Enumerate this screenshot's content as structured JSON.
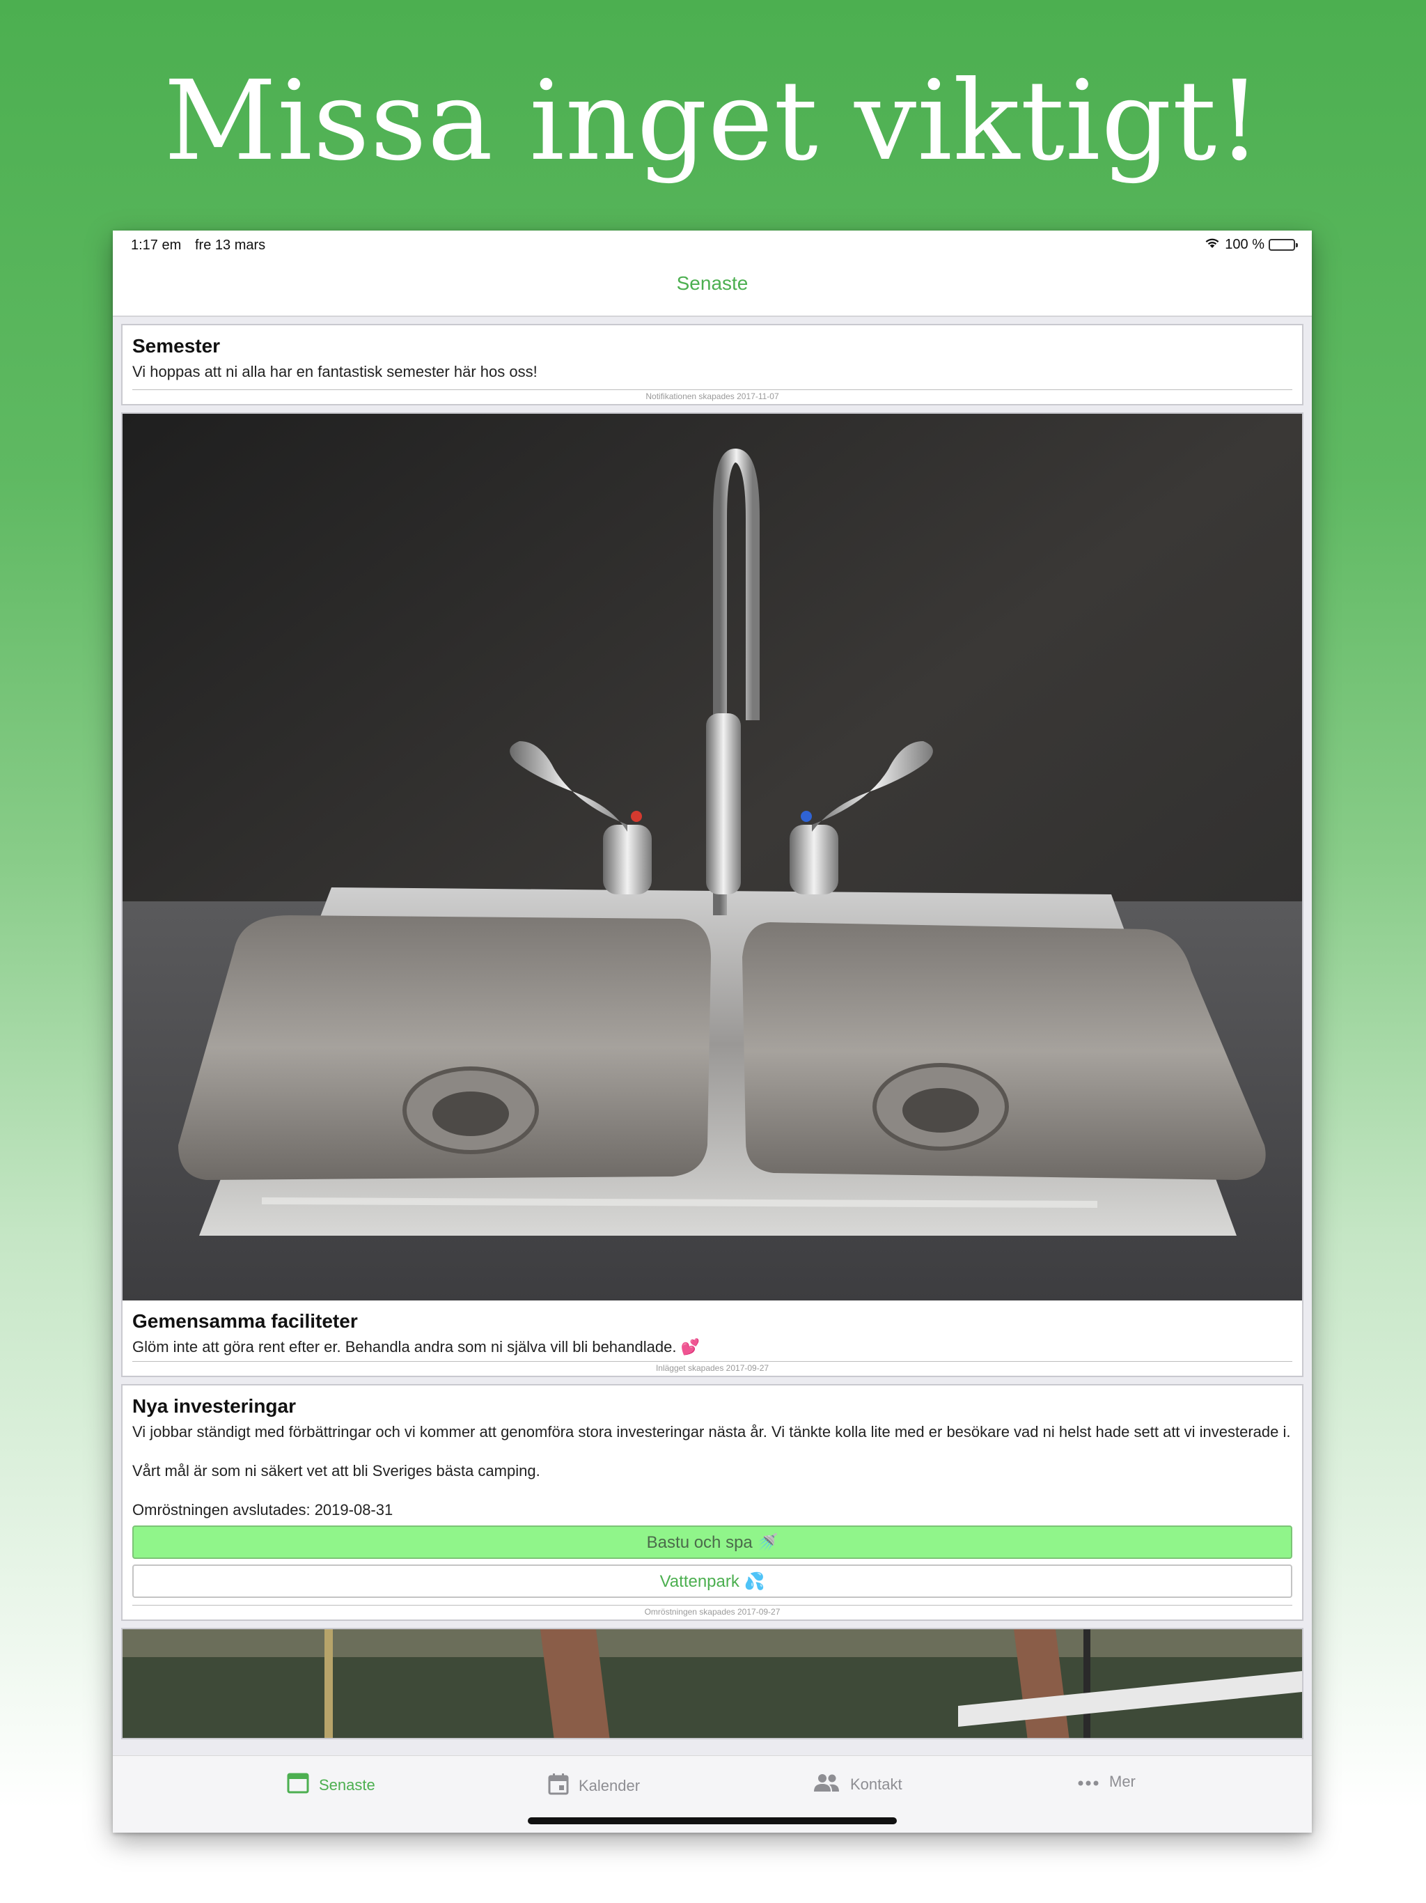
{
  "headline": "Missa inget viktigt!",
  "status_bar": {
    "time": "1:17 em",
    "date": "fre 13 mars",
    "battery": "100 %"
  },
  "nav": {
    "title": "Senaste"
  },
  "cards": {
    "semester": {
      "title": "Semester",
      "text": "Vi hoppas att ni alla har en fantastisk semester här hos oss!",
      "footer": "Notifikationen skapades 2017-11-07"
    },
    "faciliteter": {
      "title": "Gemensamma faciliteter",
      "text": "Glöm inte att göra rent efter er. Behandla andra som ni själva vill bli behandlade. 💕",
      "footer": "Inlägget skapades 2017-09-27"
    },
    "investeringar": {
      "title": "Nya investeringar",
      "paragraph1": "Vi jobbar ständigt med förbättringar och vi kommer att genomföra stora investeringar nästa år. Vi tänkte kolla lite med er besökare vad ni helst hade sett att vi investerade i.",
      "paragraph2": "Vårt mål är som ni säkert vet att bli Sveriges bästa camping.",
      "deadline": "Omröstningen avslutades: 2019-08-31",
      "options": [
        "Bastu och spa 🚿",
        "Vattenpark 💦"
      ],
      "footer": "Omröstningen skapades 2017-09-27"
    }
  },
  "tabs": [
    "Senaste",
    "Kalender",
    "Kontakt",
    "Mer"
  ],
  "colors": {
    "accent": "#4caf50",
    "selected_option": "#90f58a",
    "tab_inactive": "#8e8e93"
  },
  "icons": [
    "wifi-icon",
    "battery-icon",
    "senaste-tab-icon",
    "calendar-icon",
    "contacts-icon",
    "more-icon"
  ]
}
